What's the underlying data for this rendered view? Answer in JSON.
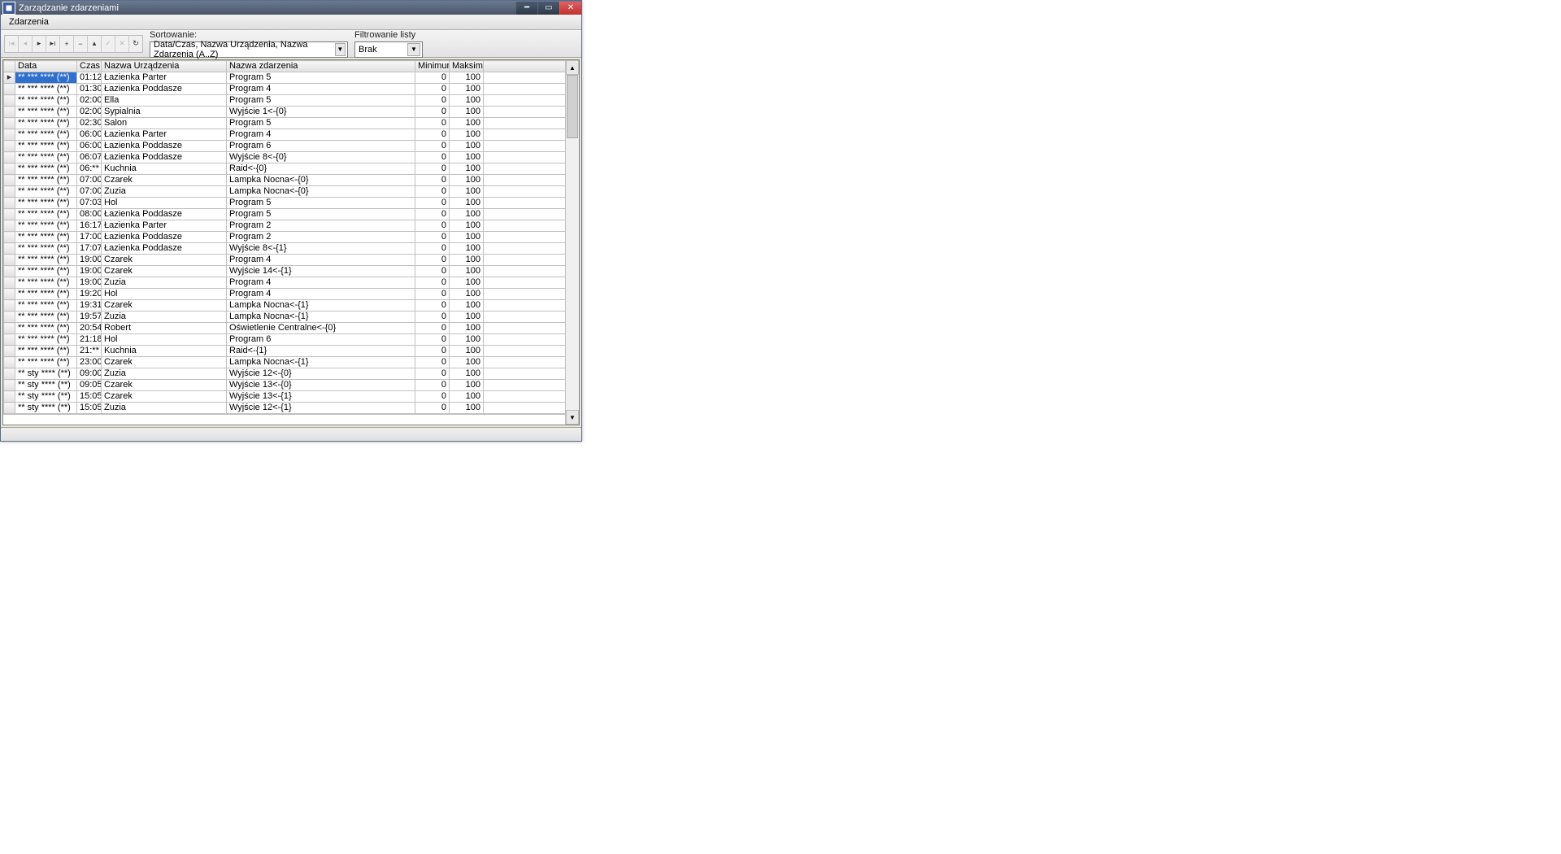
{
  "window": {
    "title": "Zarządzanie zdarzeniami"
  },
  "menubar": {
    "items": [
      "Zdarzenia"
    ]
  },
  "toolbar": {
    "sort_label": "Sortowanie:",
    "sort_value": "Data/Czas, Nazwa Urządzenia, Nazwa Zdarzenia (A..Z)",
    "filter_label": "Filtrowanie listy",
    "filter_value": "Brak"
  },
  "columns": {
    "data": "Data",
    "czas": "Czas",
    "urz": "Nazwa Urządzenia",
    "zd": "Nazwa zdarzenia",
    "min": "Minimum",
    "max": "Maksimum"
  },
  "rows": [
    {
      "data": "** *** **** (**)",
      "czas": "01:12",
      "urz": "Łazienka Parter",
      "zd": "Program 5",
      "min": "0",
      "max": "100"
    },
    {
      "data": "** *** **** (**)",
      "czas": "01:30",
      "urz": "Łazienka Poddasze",
      "zd": "Program 4",
      "min": "0",
      "max": "100"
    },
    {
      "data": "** *** **** (**)",
      "czas": "02:00",
      "urz": "Ella",
      "zd": "Program 5",
      "min": "0",
      "max": "100"
    },
    {
      "data": "** *** **** (**)",
      "czas": "02:00",
      "urz": "Sypialnia",
      "zd": "Wyjście 1<-{0}",
      "min": "0",
      "max": "100"
    },
    {
      "data": "** *** **** (**)",
      "czas": "02:30",
      "urz": "Salon",
      "zd": "Program 5",
      "min": "0",
      "max": "100"
    },
    {
      "data": "** *** **** (**)",
      "czas": "06:00",
      "urz": "Łazienka Parter",
      "zd": "Program 4",
      "min": "0",
      "max": "100"
    },
    {
      "data": "** *** **** (**)",
      "czas": "06:00",
      "urz": "Łazienka Poddasze",
      "zd": "Program 6",
      "min": "0",
      "max": "100"
    },
    {
      "data": "** *** **** (**)",
      "czas": "06:07",
      "urz": "Łazienka Poddasze",
      "zd": "Wyjście 8<-{0}",
      "min": "0",
      "max": "100"
    },
    {
      "data": "** *** **** (**)",
      "czas": "06:**",
      "urz": "Kuchnia",
      "zd": "Raid<-{0}",
      "min": "0",
      "max": "100"
    },
    {
      "data": "** *** **** (**)",
      "czas": "07:00",
      "urz": "Czarek",
      "zd": "Lampka Nocna<-{0}",
      "min": "0",
      "max": "100"
    },
    {
      "data": "** *** **** (**)",
      "czas": "07:00",
      "urz": "Zuzia",
      "zd": "Lampka Nocna<-{0}",
      "min": "0",
      "max": "100"
    },
    {
      "data": "** *** **** (**)",
      "czas": "07:03",
      "urz": "Hol",
      "zd": "Program 5",
      "min": "0",
      "max": "100"
    },
    {
      "data": "** *** **** (**)",
      "czas": "08:00",
      "urz": "Łazienka Poddasze",
      "zd": "Program 5",
      "min": "0",
      "max": "100"
    },
    {
      "data": "** *** **** (**)",
      "czas": "16:17",
      "urz": "Łazienka Parter",
      "zd": "Program 2",
      "min": "0",
      "max": "100"
    },
    {
      "data": "** *** **** (**)",
      "czas": "17:00",
      "urz": "Łazienka Poddasze",
      "zd": "Program 2",
      "min": "0",
      "max": "100"
    },
    {
      "data": "** *** **** (**)",
      "czas": "17:07",
      "urz": "Łazienka Poddasze",
      "zd": "Wyjście 8<-{1}",
      "min": "0",
      "max": "100"
    },
    {
      "data": "** *** **** (**)",
      "czas": "19:00",
      "urz": "Czarek",
      "zd": "Program 4",
      "min": "0",
      "max": "100"
    },
    {
      "data": "** *** **** (**)",
      "czas": "19:00",
      "urz": "Czarek",
      "zd": "Wyjście 14<-{1}",
      "min": "0",
      "max": "100"
    },
    {
      "data": "** *** **** (**)",
      "czas": "19:00",
      "urz": "Zuzia",
      "zd": "Program 4",
      "min": "0",
      "max": "100"
    },
    {
      "data": "** *** **** (**)",
      "czas": "19:20",
      "urz": "Hol",
      "zd": "Program 4",
      "min": "0",
      "max": "100"
    },
    {
      "data": "** *** **** (**)",
      "czas": "19:31",
      "urz": "Czarek",
      "zd": "Lampka Nocna<-{1}",
      "min": "0",
      "max": "100"
    },
    {
      "data": "** *** **** (**)",
      "czas": "19:57",
      "urz": "Zuzia",
      "zd": "Lampka Nocna<-{1}",
      "min": "0",
      "max": "100"
    },
    {
      "data": "** *** **** (**)",
      "czas": "20:54",
      "urz": "Robert",
      "zd": "Oświetlenie Centralne<-{0}",
      "min": "0",
      "max": "100"
    },
    {
      "data": "** *** **** (**)",
      "czas": "21:18",
      "urz": "Hol",
      "zd": "Program 6",
      "min": "0",
      "max": "100"
    },
    {
      "data": "** *** **** (**)",
      "czas": "21:**",
      "urz": "Kuchnia",
      "zd": "Raid<-{1}",
      "min": "0",
      "max": "100"
    },
    {
      "data": "** *** **** (**)",
      "czas": "23:00",
      "urz": "Czarek",
      "zd": "Lampka Nocna<-{1}",
      "min": "0",
      "max": "100"
    },
    {
      "data": "** sty **** (**)",
      "czas": "09:00",
      "urz": "Zuzia",
      "zd": "Wyjście 12<-{0}",
      "min": "0",
      "max": "100"
    },
    {
      "data": "** sty **** (**)",
      "czas": "09:05",
      "urz": "Czarek",
      "zd": "Wyjście 13<-{0}",
      "min": "0",
      "max": "100"
    },
    {
      "data": "** sty **** (**)",
      "czas": "15:05",
      "urz": "Czarek",
      "zd": "Wyjście 13<-{1}",
      "min": "0",
      "max": "100"
    },
    {
      "data": "** sty **** (**)",
      "czas": "15:05",
      "urz": "Zuzia",
      "zd": "Wyjście 12<-{1}",
      "min": "0",
      "max": "100"
    }
  ],
  "selected_row": 0
}
